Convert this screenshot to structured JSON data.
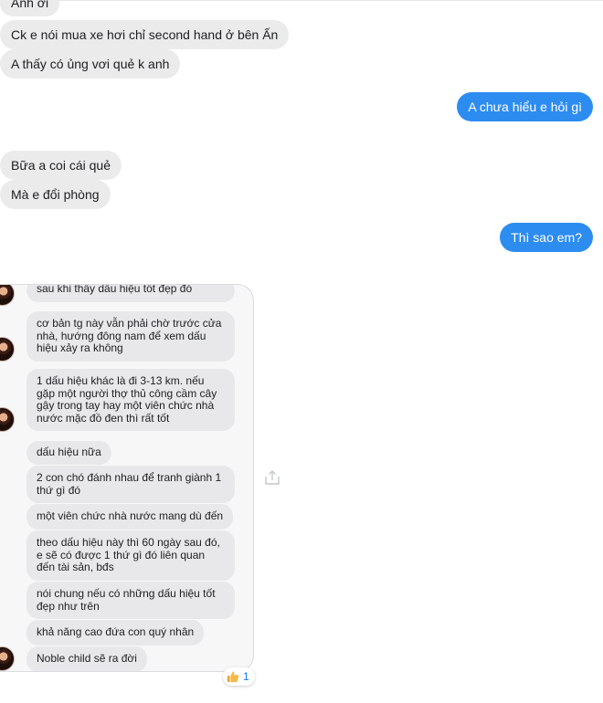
{
  "messages_top": [
    {
      "text": "Anh ơi"
    },
    {
      "text": "Ck e nói mua xe hơi chỉ second hand ở bên Ấn"
    },
    {
      "text": "A thấy có ủng vơi quẻ k anh"
    }
  ],
  "reply1": "A chưa hiểu e hỏi gì",
  "messages_mid": [
    {
      "text": "Bữa a coi cái quẻ"
    },
    {
      "text": "Mà e đổi phòng"
    }
  ],
  "reply2": "Thì sao em?",
  "shared_screenshot": {
    "messages": [
      "sau khi thấy dấu hiệu tốt đẹp đó",
      "cơ bản tg này vẫn phải chờ trước cửa nhà, hướng đông nam để xem dấu hiệu xảy ra không",
      "1 dấu hiệu khác là đi 3-13 km. nếu gặp một người thợ thủ công cầm cây gậy trong tay hay một viên chức nhà nước mặc đồ đen thì rất tốt",
      "dấu hiệu nữa",
      "2 con chó đánh nhau để tranh giành 1 thứ gì đó",
      "một viên chức nhà nước mang dù đến",
      "theo dấu hiệu này thì 60 ngày sau đó, e sẽ có được 1 thứ gì đó liên quan đến tài sản, bđs",
      "nói chung nếu có những dấu hiệu tốt đẹp như trên",
      "khả năng cao đứa con quý nhân",
      "Noble child sẽ ra đời"
    ]
  },
  "reaction": {
    "icon": "thumbs-up-icon",
    "count": "1",
    "color": "#1877f2"
  },
  "colors": {
    "outgoing": "#2d8cf0",
    "incoming": "#ebebeb"
  },
  "icons": {
    "share": "share-icon"
  }
}
